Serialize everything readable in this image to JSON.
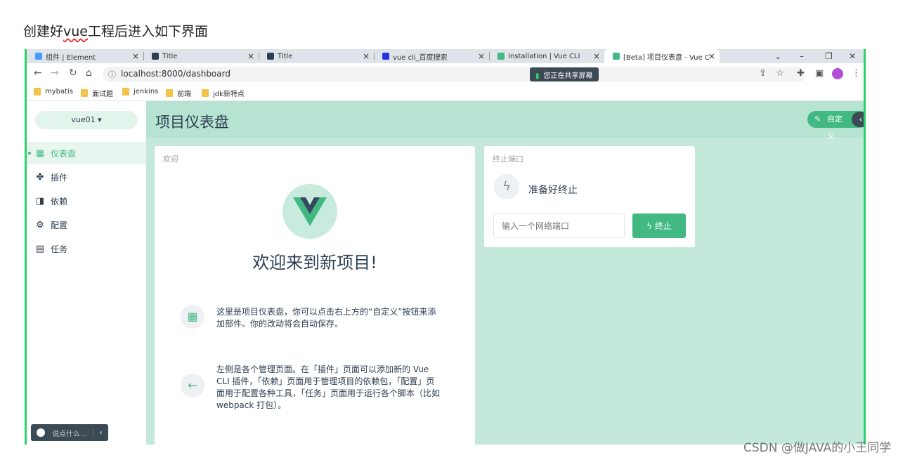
{
  "caption": {
    "before": "创建好",
    "underlined": "vue",
    "after": "工程后进入如下界面"
  },
  "browser": {
    "tabs": [
      {
        "label": "组件 | Element",
        "color": "#409eff"
      },
      {
        "label": "Title",
        "color": "#2c3e50"
      },
      {
        "label": "Title",
        "color": "#2c3e50"
      },
      {
        "label": "vue cli_百度搜索",
        "color": "#2932e1"
      },
      {
        "label": "Installation | Vue CLI",
        "color": "#42b983"
      },
      {
        "label": "[Beta] 项目仪表盘 - Vue C",
        "color": "#42b983"
      }
    ],
    "url": "localhost:8000/dashboard",
    "sharing": "您正在共享屏幕",
    "bookmarks": [
      "mybatis",
      "面试题",
      "jenkins",
      "前端",
      "jdk新特点"
    ]
  },
  "app": {
    "project": "vue01",
    "page_title": "项目仪表盘",
    "customize": "自定义",
    "menu": [
      {
        "label": "仪表盘",
        "icon": "dashboard-icon"
      },
      {
        "label": "插件",
        "icon": "puzzle-icon"
      },
      {
        "label": "依赖",
        "icon": "library-icon"
      },
      {
        "label": "配置",
        "icon": "settings-icon"
      },
      {
        "label": "任务",
        "icon": "assignment-icon"
      }
    ],
    "chat_placeholder": "说点什么...",
    "welcome": {
      "card_title": "欢迎",
      "heading": "欢迎来到新项目!",
      "tip1": "这里是项目仪表盘，你可以点击右上方的“自定义”按钮来添加部件。你的改动将会自动保存。",
      "tip2": "左侧是各个管理页面。在「插件」页面可以添加新的 Vue CLI 插件，「依赖」页面用于管理项目的依赖包，「配置」页面用于配置各种工具，「任务」页面用于运行各个脚本（比如 webpack 打包）。"
    },
    "kill_port": {
      "card_title": "终止端口",
      "status": "准备好终止",
      "placeholder": "输入一个网络端口",
      "button": "终止"
    }
  },
  "watermark": "CSDN @做JAVA的小王同学"
}
